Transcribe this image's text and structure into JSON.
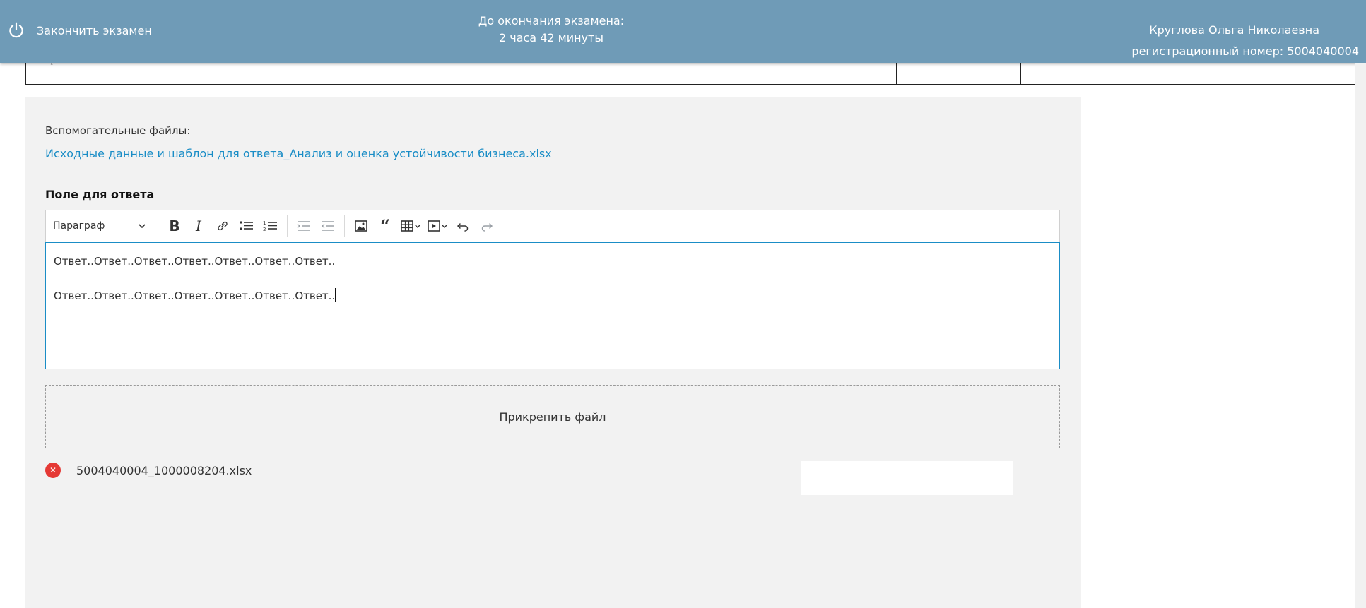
{
  "background": {
    "table_fragment_text": "тоганрассы сесоззатеньнох"
  },
  "header": {
    "finish_label": "Закончить экзамен",
    "timer_title": "До окончания экзамена:",
    "timer_value": "2 часа 42 минуты",
    "user_name": "Круглова Ольга Николаевна",
    "registration": "регистрационный номер: 5004040004",
    "background_color": "#6f9bb7"
  },
  "main": {
    "aux_files_label": "Вспомогательные файлы:",
    "aux_file_link": "Исходные данные и шаблон для ответа_Анализ и оценка устойчивости бизнеса.xlsx",
    "answer_title": "Поле для ответа",
    "toolbar": {
      "paragraph_select": "Параграф",
      "buttons": [
        "bold-icon",
        "italic-icon",
        "link-icon",
        "bulleted-list-icon",
        "numbered-list-icon",
        "indent-decrease-icon",
        "indent-increase-icon",
        "image-icon",
        "quote-icon",
        "table-icon",
        "media-icon",
        "undo-icon",
        "redo-icon"
      ]
    },
    "editor_lines": [
      "Ответ..Ответ..Ответ..Ответ..Ответ..Ответ..Ответ..",
      "Ответ..Ответ..Ответ..Ответ..Ответ..Ответ..Ответ.."
    ],
    "attach_label": "Прикрепить файл",
    "attached_file": "5004040004_1000008204.xlsx",
    "link_color": "#1a8dc6",
    "remove_color": "#e53935"
  }
}
